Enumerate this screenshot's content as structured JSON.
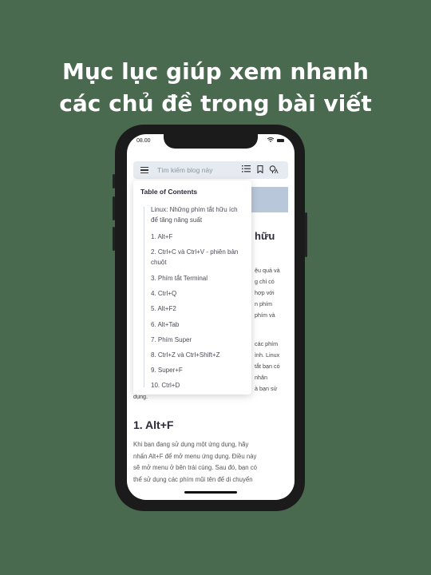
{
  "headline": {
    "line1": "Mục lục giúp xem nhanh",
    "line2": "các chủ đề trong bài viết"
  },
  "status_bar": {
    "time": "08.00",
    "icons": [
      "wifi-icon",
      "battery-icon"
    ]
  },
  "toolbar": {
    "search_placeholder": "Tìm kiếm blog này",
    "icons": [
      "menu-icon",
      "list-icon",
      "bookmark-icon",
      "text-size-icon"
    ]
  },
  "toc": {
    "title": "Table of Contents",
    "items": [
      "Linux: Những phím tắt hữu ích để tăng năng suất",
      "1. Alt+F",
      "2. Ctrl+C và Ctrl+V - phiên bản chuột",
      "3. Phím tắt Terminal",
      "4. Ctrl+Q",
      "5. Alt+F2",
      "6. Alt+Tab",
      "7. Phím Super",
      "8. Ctrl+Z và Ctrl+Shift+Z",
      "9. Super+F",
      "10. Ctrl+D"
    ]
  },
  "article": {
    "heading_partial": "hữu",
    "right_fragments": [
      "ệu quả và",
      "g chỉ có",
      "hợp với",
      "n phím",
      "phím và",
      "các phím",
      "ình. Linux",
      "tắt bạn có",
      "nhân",
      "à bạn sử"
    ],
    "tail_word": "dụng.",
    "section_title": "1. Alt+F",
    "paragraph_lines": [
      "Khi bạn đang sử dụng một ứng dụng, hãy",
      "nhấn Alt+F để mở menu ứng dụng. Điều này",
      "sẽ mở menu ở bên trái cùng. Sau đó, bạn có",
      "thể sử dụng các phím mũi tên để di chuyển"
    ]
  },
  "colors": {
    "background": "#4a6a4f",
    "phone_frame": "#1b1b1b",
    "search_bg": "#e6ebf1"
  }
}
